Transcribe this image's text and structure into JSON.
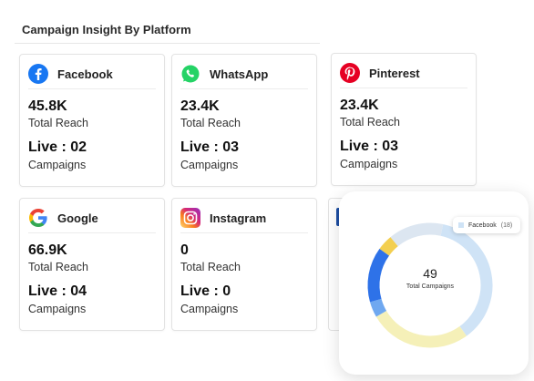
{
  "section": {
    "title": "Campaign Insight By Platform"
  },
  "cards": [
    {
      "id": "facebook",
      "name": "Facebook",
      "reach": "45.8K",
      "reach_label": "Total Reach",
      "live": "Live : 02",
      "campaigns_label": "Campaigns",
      "icon": "facebook-icon",
      "color": "#1877f2"
    },
    {
      "id": "whatsapp",
      "name": "WhatsApp",
      "reach": "23.4K",
      "reach_label": "Total Reach",
      "live": "Live : 03",
      "campaigns_label": "Campaigns",
      "icon": "whatsapp-icon",
      "color": "#25d366"
    },
    {
      "id": "pinterest",
      "name": "Pinterest",
      "reach": "23.4K",
      "reach_label": "Total Reach",
      "live": "Live : 03",
      "campaigns_label": "Campaigns",
      "icon": "pinterest-icon",
      "color": "#e60023"
    },
    {
      "id": "google",
      "name": "Google",
      "reach": "66.9K",
      "reach_label": "Total Reach",
      "live": "Live : 04",
      "campaigns_label": "Campaigns",
      "icon": "google-icon",
      "color": "#4285f4"
    },
    {
      "id": "instagram",
      "name": "Instagram",
      "reach": "0",
      "reach_label": "Total Reach",
      "live": "Live : 0",
      "campaigns_label": "Campaigns",
      "icon": "instagram-icon",
      "color": "#e1306c"
    }
  ],
  "donut": {
    "total": "49",
    "total_label": "Total Campaigns",
    "tooltip": {
      "label": "Facebook",
      "value": "(18)"
    }
  },
  "chart_data": {
    "type": "pie",
    "total": 49,
    "series": [
      {
        "name": "Facebook",
        "value": 18,
        "color": "#cfe3f6"
      },
      {
        "name": "",
        "value": 13,
        "color": "#f5f0b8"
      },
      {
        "name": "",
        "value": 2,
        "color": "#6fa8f0"
      },
      {
        "name": "",
        "value": 7,
        "color": "#2e72e8"
      },
      {
        "name": "",
        "value": 2,
        "color": "#f3cf50"
      },
      {
        "name": "",
        "value": 7,
        "color": "#dce6f1"
      }
    ]
  }
}
